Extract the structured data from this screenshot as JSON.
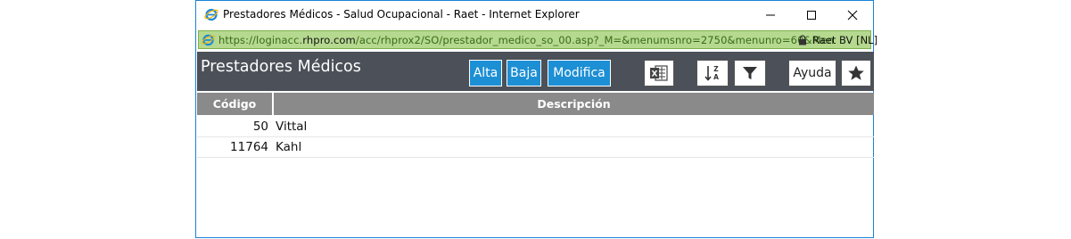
{
  "window": {
    "title": "Prestadores Médicos - Salud Ocupacional - Raet - Internet Explorer",
    "url_prefix": "https://loginacc.",
    "url_domain": "rhpro.com",
    "url_rest": "/acc/rhprox2/SO/prestador_medico_so_00.asp?_M=&menumsnro=2750&menunro=60&Men",
    "certificate": "Raet BV [NL]",
    "addressbar_color": "#b5d98f"
  },
  "header": {
    "title": "Prestadores Médicos",
    "background": "#4c5058",
    "accent": "#1d8fd4"
  },
  "toolbar": {
    "alta_label": "Alta",
    "baja_label": "Baja",
    "modifica_label": "Modifica",
    "excel_icon": "excel-icon",
    "sort_icon": "sort-az-icon",
    "filter_icon": "filter-icon",
    "ayuda_label": "Ayuda",
    "favorite_icon": "star-icon"
  },
  "table": {
    "columns": [
      "Código",
      "Descripción"
    ],
    "rows": [
      {
        "codigo": "50",
        "descripcion": "Vittal"
      },
      {
        "codigo": "11764",
        "descripcion": "Kahl"
      }
    ]
  }
}
